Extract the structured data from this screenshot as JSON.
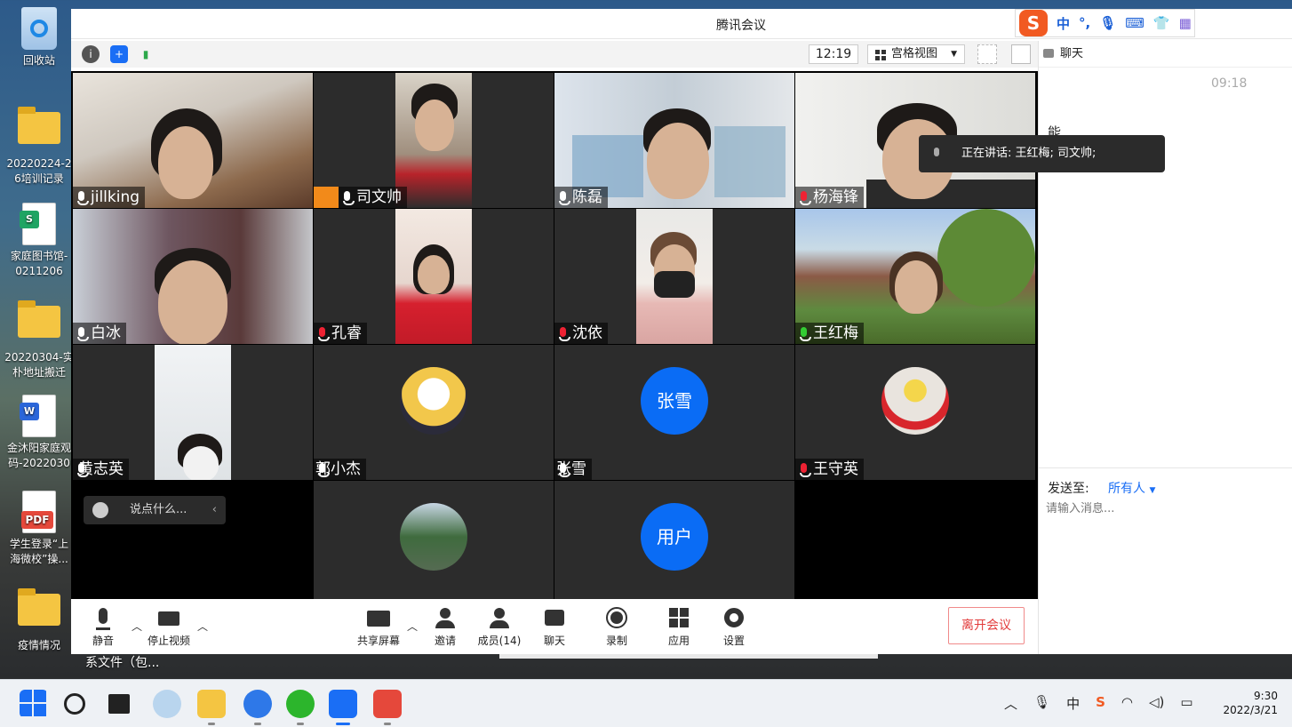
{
  "desktop": {
    "icons": [
      {
        "label": "回收站",
        "type": "recycle"
      },
      {
        "label": "20220224-2 6培训记录",
        "type": "folder"
      },
      {
        "label": "家庭图书馆- 0211206",
        "type": "sheet"
      },
      {
        "label": "20220304-实 朴地址搬迁",
        "type": "folder"
      },
      {
        "label": "金沐阳家庭观 码-2022030",
        "type": "word"
      },
      {
        "label": "学生登录“上 海微校”操...",
        "type": "pdf"
      },
      {
        "label": "疫情情况",
        "type": "folder"
      }
    ],
    "bottom_file_label": "系文件（包..."
  },
  "window": {
    "title": "腾讯会议",
    "clock": "12:19",
    "view_mode": "宫格视图",
    "speaking": "正在讲话: 王红梅; 司文帅;",
    "chat_input_placeholder": "说点什么...",
    "ime": {
      "mode": "中",
      "punct": "°,"
    }
  },
  "participants": [
    {
      "name": "jillking",
      "mic": "on",
      "kind": "video"
    },
    {
      "name": "司文帅",
      "mic": "on",
      "kind": "video",
      "host": true
    },
    {
      "name": "陈磊",
      "mic": "on",
      "kind": "video"
    },
    {
      "name": "杨海锋",
      "mic": "muted",
      "kind": "video"
    },
    {
      "name": "白冰",
      "mic": "on",
      "kind": "video"
    },
    {
      "name": "孔睿",
      "mic": "muted",
      "kind": "video"
    },
    {
      "name": "沈依",
      "mic": "muted",
      "kind": "video"
    },
    {
      "name": "王红梅",
      "mic": "talking",
      "kind": "video"
    },
    {
      "name": "黄志英",
      "mic": "none",
      "kind": "video"
    },
    {
      "name": "郭小杰",
      "mic": "none",
      "kind": "avatar-img"
    },
    {
      "name": "张雪",
      "mic": "none",
      "kind": "avatar-text",
      "avatar_text": "张雪"
    },
    {
      "name": "王守英",
      "mic": "muted",
      "kind": "avatar-img"
    },
    {
      "name": "",
      "mic": "none",
      "kind": "empty"
    },
    {
      "name": "",
      "mic": "none",
      "kind": "avatar-img"
    },
    {
      "name": "",
      "mic": "none",
      "kind": "avatar-text",
      "avatar_text": "用户"
    }
  ],
  "controls": {
    "mute": "静音",
    "stop_video": "停止视频",
    "share": "共享屏幕",
    "invite": "邀请",
    "members": "成员(14)",
    "chat": "聊天",
    "record": "录制",
    "apps": "应用",
    "settings": "设置",
    "leave": "离开会议"
  },
  "chat": {
    "title": "聊天",
    "message_time": "09:18",
    "message_text": "能",
    "send_to_label": "发送至:",
    "send_to_value": "所有人",
    "input_placeholder": "请输入消息..."
  },
  "taskbar": {
    "time": "9:30",
    "date": "2022/3/21",
    "lang": "中"
  },
  "colors": {
    "accent": "#0a6cf5",
    "leave": "#e23b3b",
    "talking": "#2ca84a"
  }
}
